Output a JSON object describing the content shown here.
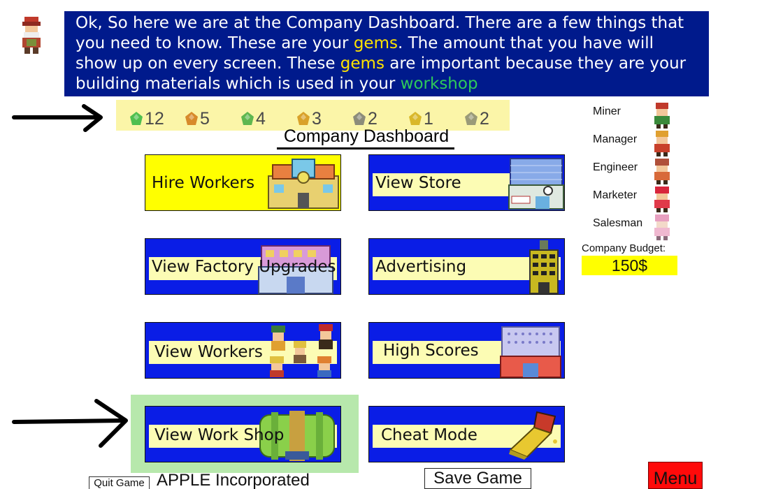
{
  "dialog": {
    "p1": "Ok, So here we are at the Company Dashboard. There are a few things that you need to know. These are your ",
    "gems1": "gems",
    "p2": ". The amount that you have will show up on every screen. These ",
    "gems2": "gems",
    "p3": " are important because they are your building materials which is used in your ",
    "workshop": "workshop"
  },
  "gems": [
    {
      "count": "12",
      "color": "#4fbf4f"
    },
    {
      "count": "5",
      "color": "#d78a2b"
    },
    {
      "count": "4",
      "color": "#5fb74f"
    },
    {
      "count": "3",
      "color": "#d9a22a"
    },
    {
      "count": "2",
      "color": "#8c8c7a"
    },
    {
      "count": "1",
      "color": "#d9b82a"
    },
    {
      "count": "2",
      "color": "#9a9a78"
    }
  ],
  "dashboard_title": "Company Dashboard",
  "tiles": {
    "hire_workers": "Hire Workers",
    "view_store": "View Store",
    "view_factory_upgrades": "View Factory Upgrades",
    "advertising": "Advertising",
    "view_workers": "View Workers",
    "high_scores": "High Scores",
    "view_work_shop": "View Work Shop",
    "cheat_mode": "Cheat Mode"
  },
  "roles": [
    {
      "label": "Miner",
      "color": "#c0392b"
    },
    {
      "label": "Manager",
      "color": "#e0a030"
    },
    {
      "label": "Engineer",
      "color": "#b0503a"
    },
    {
      "label": "Marketer",
      "color": "#d8263c"
    },
    {
      "label": "Salesman",
      "color": "#e8a0c0"
    }
  ],
  "budget": {
    "label": "Company Budget:",
    "value": "150$"
  },
  "bottom": {
    "quit": "Quit Game",
    "company": "APPLE Incorporated",
    "save": "Save Game",
    "menu": "Menu"
  }
}
